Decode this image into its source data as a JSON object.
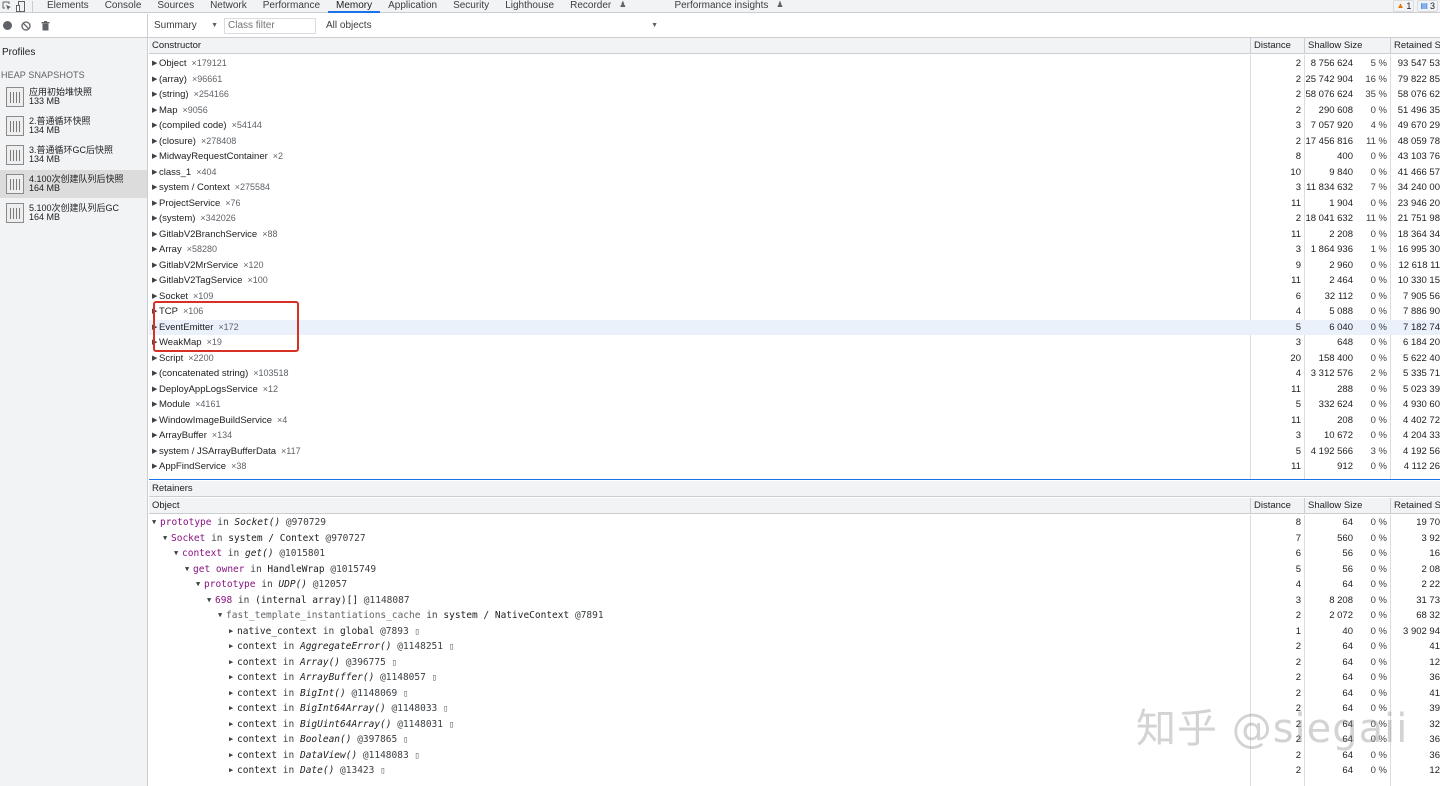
{
  "tabs": [
    "Elements",
    "Console",
    "Sources",
    "Network",
    "Performance",
    "Memory",
    "Application",
    "Security",
    "Lighthouse",
    "Recorder",
    "Performance insights"
  ],
  "active_tab": "Memory",
  "badges": {
    "warnings": "1",
    "messages": "3"
  },
  "toolbar": {
    "view": "Summary",
    "class_filter_placeholder": "Class filter",
    "objects": "All objects"
  },
  "sidebar": {
    "profiles_title": "Profiles",
    "heap_title": "HEAP SNAPSHOTS",
    "snapshots": [
      {
        "name": "应用初始堆快照",
        "size": "133 MB"
      },
      {
        "name": "2.普通循环快照",
        "size": "134 MB"
      },
      {
        "name": "3.普通循环GC后快照",
        "size": "134 MB"
      },
      {
        "name": "4.100次创建队列后快照",
        "size": "164 MB"
      },
      {
        "name": "5.100次创建队列后GC",
        "size": "164 MB"
      }
    ]
  },
  "summary": {
    "headers": {
      "constructor": "Constructor",
      "distance": "Distance",
      "shallow": "Shallow Size",
      "retained": "Retained S"
    },
    "rows": [
      {
        "name": "Object",
        "count": "×179121",
        "distance": "2",
        "shallow": "8 756 624",
        "shallow_pct": "5 %",
        "retained": "93 547 53"
      },
      {
        "name": "(array)",
        "count": "×96661",
        "distance": "2",
        "shallow": "25 742 904",
        "shallow_pct": "16 %",
        "retained": "79 822 85"
      },
      {
        "name": "(string)",
        "count": "×254166",
        "distance": "2",
        "shallow": "58 076 624",
        "shallow_pct": "35 %",
        "retained": "58 076 62"
      },
      {
        "name": "Map",
        "count": "×9056",
        "distance": "2",
        "shallow": "290 608",
        "shallow_pct": "0 %",
        "retained": "51 496 35"
      },
      {
        "name": "(compiled code)",
        "count": "×54144",
        "distance": "3",
        "shallow": "7 057 920",
        "shallow_pct": "4 %",
        "retained": "49 670 29"
      },
      {
        "name": "(closure)",
        "count": "×278408",
        "distance": "2",
        "shallow": "17 456 816",
        "shallow_pct": "11 %",
        "retained": "48 059 78"
      },
      {
        "name": "MidwayRequestContainer",
        "count": "×2",
        "distance": "8",
        "shallow": "400",
        "shallow_pct": "0 %",
        "retained": "43 103 76"
      },
      {
        "name": "class_1",
        "count": "×404",
        "distance": "10",
        "shallow": "9 840",
        "shallow_pct": "0 %",
        "retained": "41 466 57"
      },
      {
        "name": "system / Context",
        "count": "×275584",
        "distance": "3",
        "shallow": "11 834 632",
        "shallow_pct": "7 %",
        "retained": "34 240 00"
      },
      {
        "name": "ProjectService",
        "count": "×76",
        "distance": "11",
        "shallow": "1 904",
        "shallow_pct": "0 %",
        "retained": "23 946 20"
      },
      {
        "name": "(system)",
        "count": "×342026",
        "distance": "2",
        "shallow": "18 041 632",
        "shallow_pct": "11 %",
        "retained": "21 751 98"
      },
      {
        "name": "GitlabV2BranchService",
        "count": "×88",
        "distance": "11",
        "shallow": "2 208",
        "shallow_pct": "0 %",
        "retained": "18 364 34"
      },
      {
        "name": "Array",
        "count": "×58280",
        "distance": "3",
        "shallow": "1 864 936",
        "shallow_pct": "1 %",
        "retained": "16 995 30"
      },
      {
        "name": "GitlabV2MrService",
        "count": "×120",
        "distance": "9",
        "shallow": "2 960",
        "shallow_pct": "0 %",
        "retained": "12 618 11"
      },
      {
        "name": "GitlabV2TagService",
        "count": "×100",
        "distance": "11",
        "shallow": "2 464",
        "shallow_pct": "0 %",
        "retained": "10 330 15"
      },
      {
        "name": "Socket",
        "count": "×109",
        "distance": "6",
        "shallow": "32 112",
        "shallow_pct": "0 %",
        "retained": "7 905 56"
      },
      {
        "name": "TCP",
        "count": "×106",
        "distance": "4",
        "shallow": "5 088",
        "shallow_pct": "0 %",
        "retained": "7 886 90"
      },
      {
        "name": "EventEmitter",
        "count": "×172",
        "distance": "5",
        "shallow": "6 040",
        "shallow_pct": "0 %",
        "retained": "7 182 74"
      },
      {
        "name": "WeakMap",
        "count": "×19",
        "distance": "3",
        "shallow": "648",
        "shallow_pct": "0 %",
        "retained": "6 184 20"
      },
      {
        "name": "Script",
        "count": "×2200",
        "distance": "20",
        "shallow": "158 400",
        "shallow_pct": "0 %",
        "retained": "5 622 40"
      },
      {
        "name": "(concatenated string)",
        "count": "×103518",
        "distance": "4",
        "shallow": "3 312 576",
        "shallow_pct": "2 %",
        "retained": "5 335 71"
      },
      {
        "name": "DeployAppLogsService",
        "count": "×12",
        "distance": "11",
        "shallow": "288",
        "shallow_pct": "0 %",
        "retained": "5 023 39"
      },
      {
        "name": "Module",
        "count": "×4161",
        "distance": "5",
        "shallow": "332 624",
        "shallow_pct": "0 %",
        "retained": "4 930 60"
      },
      {
        "name": "WindowImageBuildService",
        "count": "×4",
        "distance": "11",
        "shallow": "208",
        "shallow_pct": "0 %",
        "retained": "4 402 72"
      },
      {
        "name": "ArrayBuffer",
        "count": "×134",
        "distance": "3",
        "shallow": "10 672",
        "shallow_pct": "0 %",
        "retained": "4 204 33"
      },
      {
        "name": "system / JSArrayBufferData",
        "count": "×117",
        "distance": "5",
        "shallow": "4 192 566",
        "shallow_pct": "3 %",
        "retained": "4 192 56"
      },
      {
        "name": "AppFindService",
        "count": "×38",
        "distance": "11",
        "shallow": "912",
        "shallow_pct": "0 %",
        "retained": "4 112 26"
      }
    ]
  },
  "retainers": {
    "title": "Retainers",
    "headers": {
      "object": "Object",
      "distance": "Distance",
      "shallow": "Shallow Size",
      "retained": "Retained S"
    },
    "rows": [
      {
        "indent": 0,
        "open": true,
        "prop": "prototype",
        "in": "in",
        "obj": "Socket()",
        "obj_fn": true,
        "addr": "@970729",
        "distance": "8",
        "shallow": "64",
        "pct": "0 %",
        "retained": "19 70"
      },
      {
        "indent": 1,
        "open": true,
        "prop": "Socket",
        "in": "in",
        "obj": "system / Context",
        "obj_fn": false,
        "addr": "@970727",
        "distance": "7",
        "shallow": "560",
        "pct": "0 %",
        "retained": "3 92"
      },
      {
        "indent": 2,
        "open": true,
        "prop": "context",
        "in": "in",
        "obj": "get()",
        "obj_fn": true,
        "addr": "@1015801",
        "distance": "6",
        "shallow": "56",
        "pct": "0 %",
        "retained": "16"
      },
      {
        "indent": 3,
        "open": true,
        "prop": "get owner",
        "in": "in",
        "obj": "HandleWrap",
        "obj_fn": false,
        "addr": "@1015749",
        "distance": "5",
        "shallow": "56",
        "pct": "0 %",
        "retained": "2 08"
      },
      {
        "indent": 4,
        "open": true,
        "prop": "prototype",
        "in": "in",
        "obj": "UDP()",
        "obj_fn": true,
        "addr": "@12057",
        "distance": "4",
        "shallow": "64",
        "pct": "0 %",
        "retained": "2 22"
      },
      {
        "indent": 5,
        "open": true,
        "prop": "698",
        "in": "in",
        "obj": "(internal array)[]",
        "obj_fn": false,
        "addr": "@1148087",
        "distance": "3",
        "shallow": "8 208",
        "pct": "0 %",
        "retained": "31 73"
      },
      {
        "indent": 6,
        "open": true,
        "prop": "fast_template_instantiations_cache",
        "in": "in",
        "obj": "system / NativeContext",
        "obj_fn": false,
        "addr": "@7891",
        "distance": "2",
        "shallow": "2 072",
        "pct": "0 %",
        "retained": "68 32"
      },
      {
        "indent": 7,
        "open": false,
        "prop": "native_context",
        "in": "in",
        "obj": "global",
        "obj_fn": false,
        "addr": "@7893",
        "glyph": "▯",
        "distance": "1",
        "shallow": "40",
        "pct": "0 %",
        "retained": "3 902 94"
      },
      {
        "indent": 7,
        "open": false,
        "prop": "context",
        "in": "in",
        "obj": "AggregateError()",
        "obj_fn": true,
        "addr": "@1148251",
        "glyph": "▯",
        "distance": "2",
        "shallow": "64",
        "pct": "0 %",
        "retained": "41"
      },
      {
        "indent": 7,
        "open": false,
        "prop": "context",
        "in": "in",
        "obj": "Array()",
        "obj_fn": true,
        "addr": "@396775",
        "glyph": "▯",
        "distance": "2",
        "shallow": "64",
        "pct": "0 %",
        "retained": "12"
      },
      {
        "indent": 7,
        "open": false,
        "prop": "context",
        "in": "in",
        "obj": "ArrayBuffer()",
        "obj_fn": true,
        "addr": "@1148057",
        "glyph": "▯",
        "distance": "2",
        "shallow": "64",
        "pct": "0 %",
        "retained": "36"
      },
      {
        "indent": 7,
        "open": false,
        "prop": "context",
        "in": "in",
        "obj": "BigInt()",
        "obj_fn": true,
        "addr": "@1148069",
        "glyph": "▯",
        "distance": "2",
        "shallow": "64",
        "pct": "0 %",
        "retained": "41"
      },
      {
        "indent": 7,
        "open": false,
        "prop": "context",
        "in": "in",
        "obj": "BigInt64Array()",
        "obj_fn": true,
        "addr": "@1148033",
        "glyph": "▯",
        "distance": "2",
        "shallow": "64",
        "pct": "0 %",
        "retained": "39"
      },
      {
        "indent": 7,
        "open": false,
        "prop": "context",
        "in": "in",
        "obj": "BigUint64Array()",
        "obj_fn": true,
        "addr": "@1148031",
        "glyph": "▯",
        "distance": "2",
        "shallow": "64",
        "pct": "0 %",
        "retained": "32"
      },
      {
        "indent": 7,
        "open": false,
        "prop": "context",
        "in": "in",
        "obj": "Boolean()",
        "obj_fn": true,
        "addr": "@397865",
        "glyph": "▯",
        "distance": "2",
        "shallow": "64",
        "pct": "0 %",
        "retained": "36"
      },
      {
        "indent": 7,
        "open": false,
        "prop": "context",
        "in": "in",
        "obj": "DataView()",
        "obj_fn": true,
        "addr": "@1148083",
        "glyph": "▯",
        "distance": "2",
        "shallow": "64",
        "pct": "0 %",
        "retained": "36"
      },
      {
        "indent": 7,
        "open": false,
        "prop": "context",
        "in": "in",
        "obj": "Date()",
        "obj_fn": true,
        "addr": "@13423",
        "glyph": "▯",
        "distance": "2",
        "shallow": "64",
        "pct": "0 %",
        "retained": "12"
      }
    ]
  },
  "watermark": "知乎 @siegaii"
}
